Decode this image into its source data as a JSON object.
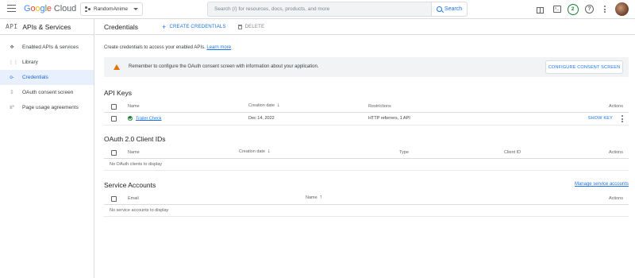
{
  "header": {
    "logo_parts": [
      "G",
      "o",
      "o",
      "g",
      "l",
      "e"
    ],
    "logo_product": "Cloud",
    "project_name": "RandomAnime",
    "search_placeholder": "Search (/) for resources, docs, products, and more",
    "search_button": "Search",
    "notification_count": "2"
  },
  "sidebar": {
    "badge": "API",
    "title": "APIs & Services",
    "items": [
      {
        "label": "Enabled APIs & services",
        "icon": "diamond-icon"
      },
      {
        "label": "Library",
        "icon": "grid-icon"
      },
      {
        "label": "Credentials",
        "icon": "key-icon",
        "active": true
      },
      {
        "label": "OAuth consent screen",
        "icon": "consent-icon"
      },
      {
        "label": "Page usage agreements",
        "icon": "settings-list-icon"
      }
    ]
  },
  "main": {
    "title": "Credentials",
    "create_label": "CREATE CREDENTIALS",
    "delete_label": "DELETE",
    "intro_text": "Create credentials to access your enabled APIs.",
    "learn_more": "Learn more",
    "banner_text": "Remember to configure the OAuth consent screen with information about your application.",
    "consent_button": "CONFIGURE CONSENT SCREEN"
  },
  "api_keys": {
    "title": "API Keys",
    "columns": {
      "name": "Name",
      "creation": "Creation date",
      "restrictions": "Restrictions",
      "actions": "Actions"
    },
    "rows": [
      {
        "name": "Trailer Check",
        "creation": "Dec 14, 2022",
        "restrictions": "HTTP referrers, 1 API",
        "action": "SHOW KEY"
      }
    ]
  },
  "oauth": {
    "title": "OAuth 2.0 Client IDs",
    "columns": {
      "name": "Name",
      "creation": "Creation date",
      "type": "Type",
      "client_id": "Client ID",
      "actions": "Actions"
    },
    "empty": "No OAuth clients to display"
  },
  "service_accounts": {
    "title": "Service Accounts",
    "manage_link": "Manage service accounts",
    "columns": {
      "email": "Email",
      "name": "Name",
      "actions": "Actions"
    },
    "empty": "No service accounts to display"
  },
  "colors": {
    "accent": "#1a73e8",
    "warning": "#e37400",
    "success": "#188038",
    "active_bg": "#e8f0fe"
  }
}
